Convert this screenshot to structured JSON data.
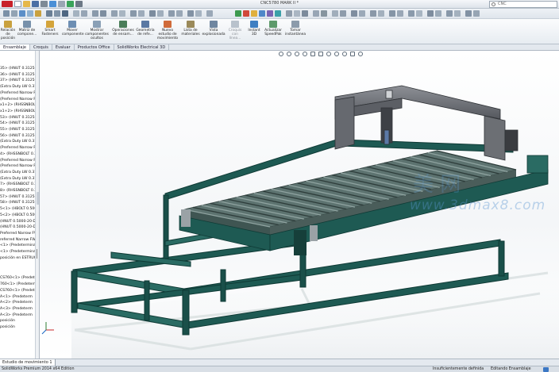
{
  "window": {
    "title": "CNC5780 MARK II *",
    "search_placeholder": "CNC"
  },
  "ribbon": {
    "buttons": [
      {
        "label": "Insertar componentes"
      },
      {
        "label": "Relación de posición"
      },
      {
        "label": "Matriz de compone..."
      },
      {
        "label": "Smart Fasteners"
      },
      {
        "label": "Mover componente"
      },
      {
        "label": "Mostrar componentes ocultos"
      },
      {
        "label": "Operaciones de ensam..."
      },
      {
        "label": "Geometría de refe..."
      },
      {
        "label": "Nuevo estudio de movimiento"
      },
      {
        "label": "Lista de materiales"
      },
      {
        "label": "Vista explosionada"
      },
      {
        "label": "Croquis con línea..."
      },
      {
        "label": "Instant 3D"
      },
      {
        "label": "Actualizar SpeedPak"
      },
      {
        "label": "Tomar instantánea"
      }
    ]
  },
  "tabs": [
    {
      "label": "Ensamblaje"
    },
    {
      "label": "Croquis"
    },
    {
      "label": "Evaluar"
    },
    {
      "label": "Productos Office"
    },
    {
      "label": "SolidWorks Electrical 3D"
    }
  ],
  "tree": {
    "items": [
      "35> (HNUT 0.3125-18-D-N)",
      "36> (HNUT 0.3125-18-D-N)",
      "37> (HNUT 0.3125-18-D-N)",
      "(Extra Duty LW 0.31)",
      "(Preferred Narrow FW)",
      "(Preferred Narrow FW)",
      "x1+2> (RHSSNBOLT)",
      "x1+2> (RHSSNBOLT)",
      "53> (HNUT 0.3125-18)",
      "54> (HNUT 0.3125-18)",
      "55> (HNUT 0.3125-18)",
      "56> (HNUT 0.3125-18)",
      "(Extra Duty LW 0.31)",
      "(Preferred Narrow FW)",
      "4> (RHSSNBOLT 0.31)",
      "(Preferred Narrow FW)",
      "(Preferred Narrow FW)",
      "(Extra Duty LW 0.31)",
      "(Extra Duty LW 0.31)",
      "7> (RHSSNBOLT 0.31)",
      "8> (RHSSNBOLT 0.31)",
      "57> (HNUT 0.3125-18)",
      "58> (HNUT 0.3125-18)",
      "5<1> (HBOLT 0.5000)",
      "5<2> (HBOLT 0.5000)",
      "(HNUT 0.5000-20-D)",
      "(HNUT 0.5000-20-D)",
      "Preferred Narrow FW",
      "referred Narrow FW",
      "<1> (Predeterminado)",
      "<1> (Predeterminad",
      "posición en ESTRUC",
      "CS760<1> (Predeterm",
      "760<1> (Predeterm",
      "CS760<1> (Predeterm",
      "A<1> (Predeterm",
      "A<2> (Predeterm",
      "A<3> (Predeterm",
      "A<3> (Predeterm",
      "posición",
      "posición"
    ]
  },
  "bottom_tab": {
    "label": "Estudio de movimiento 1"
  },
  "status": {
    "edition": "SolidWorks Premium 2014 x64 Edition",
    "defined": "Insuficientemente definida",
    "mode": "Editando Ensamblaje"
  },
  "watermark": {
    "site": "www.3dmax8.com"
  },
  "colors": {
    "frame": "#1e5a53",
    "frame_dark": "#0f3a35",
    "gantry": "#6c6f74",
    "slats": "#4a5d5a",
    "ribbon_bg": "#eef2f6"
  }
}
